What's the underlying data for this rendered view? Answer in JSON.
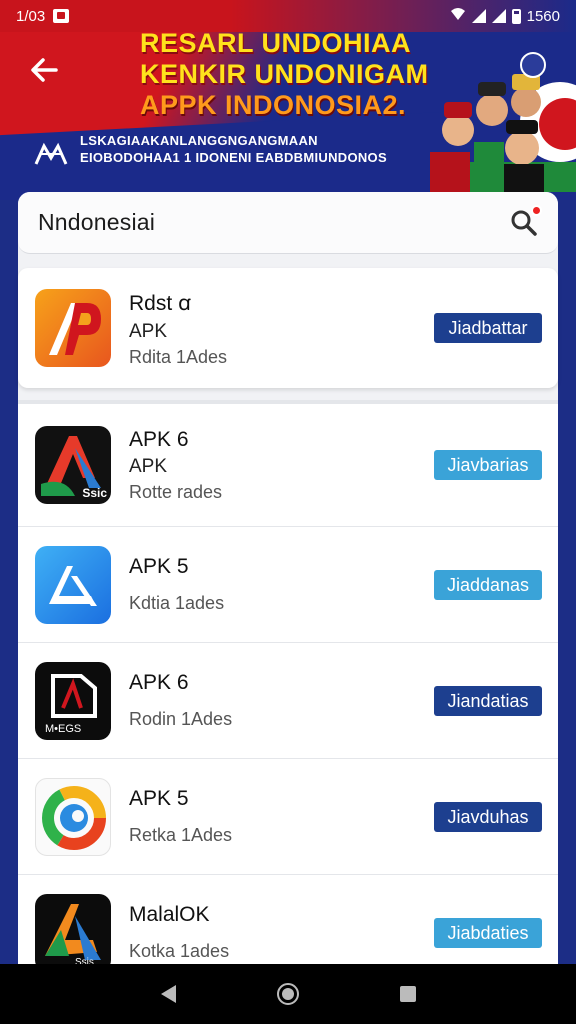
{
  "status_bar": {
    "time": "1/03",
    "right_text": "1560"
  },
  "banner": {
    "title_line1": "RESARL UNDOHIAA",
    "title_line2": "KENKIR UNDONIGAM",
    "title_line3": "APPK INDONOSIA2.",
    "subtitle_line1": "LSKAGIAAKANLANGGNGANGMAAN",
    "subtitle_line2": "EIOBODOHAA1 1 IDONENI EABDBMIUNDONOS"
  },
  "search": {
    "query": "Nndonesiai"
  },
  "apps": [
    {
      "name": "Rdst ꭤ",
      "type": "APK",
      "meta": "Rdita 1Ades",
      "button": "Jiadbattar",
      "button_style": "dark",
      "icon": "orange-p-logo-icon"
    },
    {
      "name": "APK 6",
      "type": "APK",
      "meta": "Rotte rades",
      "button": "Jiavbarias",
      "button_style": "light",
      "icon": "red-a-logo-icon",
      "icon_caption": "Ssic"
    },
    {
      "name": "APK 5",
      "type": "",
      "meta": "Kdtia 1ades",
      "button": "Jiaddanas",
      "button_style": "light",
      "icon": "blue-a-logo-icon"
    },
    {
      "name": "APK 6",
      "type": "",
      "meta": "Rodin 1Ades",
      "button": "Jiandatias",
      "button_style": "dark",
      "icon": "black-d-logo-icon",
      "icon_caption": "M•EGS"
    },
    {
      "name": "APK 5",
      "type": "",
      "meta": "Retka 1Ades",
      "button": "Jiavduhas",
      "button_style": "dark",
      "icon": "colorful-ring-logo-icon"
    },
    {
      "name": "MalalOK",
      "type": "",
      "meta": "Kotka 1ades",
      "button": "Jiabdaties",
      "button_style": "light",
      "icon": "gradient-a-logo-icon",
      "icon_caption": "Ssis"
    }
  ],
  "colors": {
    "banner_red": "#d0161e",
    "banner_blue": "#1b2a8a",
    "btn_dark": "#1d3f8f",
    "btn_light": "#3aa3d8"
  }
}
